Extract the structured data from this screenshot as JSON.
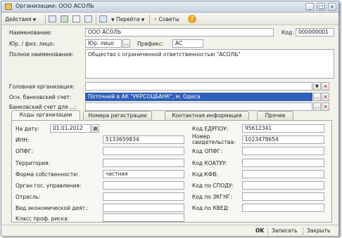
{
  "window": {
    "title": "Организации: ООО АСОЛЬ",
    "controls": [
      "_",
      "□",
      "×"
    ]
  },
  "toolbar": {
    "actions_label": "Действия",
    "goto_label": "Перейти",
    "advice_label": "Советы",
    "help_glyph": "?"
  },
  "form": {
    "name_label": "Наименование:",
    "name_value": "ООО АСОЛЬ",
    "code_label": "Код:",
    "code_value": "000000001",
    "entity_label": "Юр. / физ. лицо:",
    "entity_value": "Юр. лицо",
    "prefix_label": "Префикс:",
    "prefix_value": "АС",
    "fullname_label": "Полное наименование:",
    "fullname_value": "Общество с ограниченной ответственностью \"АСОЛЬ\"",
    "parent_label": "Головная организация:",
    "parent_value": "",
    "bank_label": "Осн. банковский счет:",
    "bank_value": "Поточний в АК \"УКРСОЦБАНК\", м. Одеса",
    "bank2_label": "Банковский счет для ...:",
    "bank2_value": ""
  },
  "tabs": [
    {
      "label": "Коды организации"
    },
    {
      "label": "Номера регистрации"
    },
    {
      "label": "Контактная информация"
    },
    {
      "label": "Прочее"
    }
  ],
  "codes": {
    "date_label": "На дату:",
    "date_value": "01.01.2012",
    "inn_label": "ИНН:",
    "inn_value": "5133659834",
    "opf_label": "ОПФГ:",
    "opf_value": "",
    "territory_label": "Территория:",
    "territory_value": "",
    "ownership_label": "Форма собственности:",
    "ownership_value": "частная",
    "gov_label": "Орган гос. управления:",
    "gov_value": "",
    "branch_label": "Отрасль:",
    "branch_value": "",
    "activity_label": "Вид экономической деят.:",
    "activity_value": "",
    "risk_label": "Класс проф. риска:",
    "risk_value": "",
    "edrpou_label": "Код ЕДРПОУ:",
    "edrpou_value": "95612341",
    "cert_label_1": "Номер",
    "cert_label_2": "свидетельства:",
    "cert_value": "1023478654",
    "kopfg_label": "Код ОПФГ:",
    "kopfg_value": "",
    "koatuu_label": "Код КОАТУУ:",
    "koatuu_value": "",
    "kfv_label": "Код КФВ:",
    "kfv_value": "",
    "spodu_label": "Код по СПОДУ:",
    "spodu_value": "",
    "zkgng_label": "Код по ЗКГНГ:",
    "zkgng_value": "",
    "kved_label": "Код по КВЕД:",
    "kved_value": ""
  },
  "footer": {
    "ok_label": "OK",
    "save_label": "Записать",
    "close_label": "Закрыть"
  }
}
